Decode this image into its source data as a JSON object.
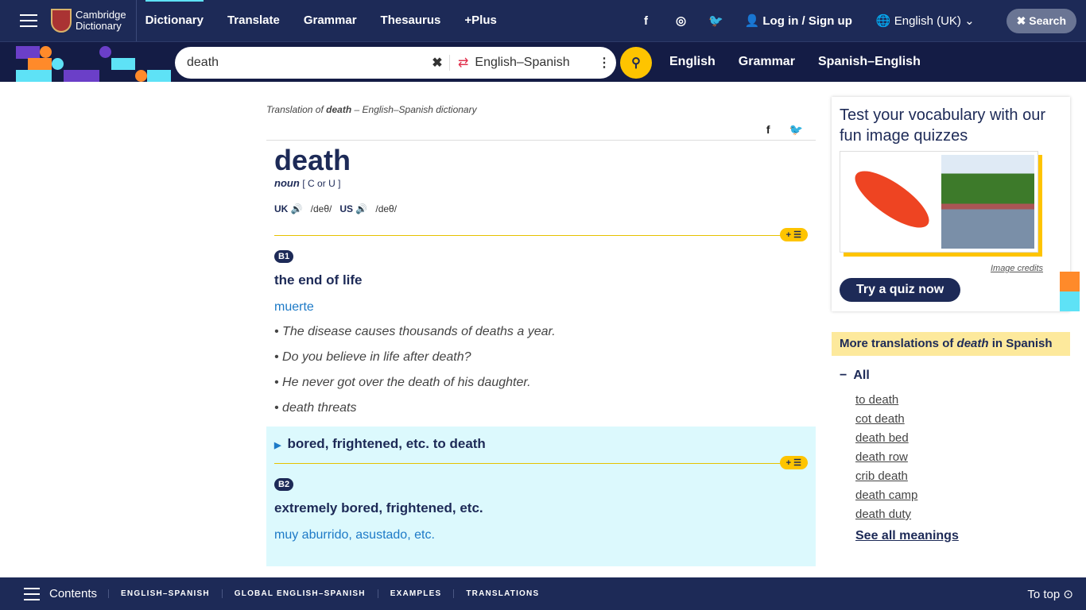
{
  "header": {
    "logo_line1": "Cambridge",
    "logo_line2": "Dictionary",
    "nav": [
      {
        "label": "Dictionary",
        "active": true
      },
      {
        "label": "Translate"
      },
      {
        "label": "Grammar"
      },
      {
        "label": "Thesaurus"
      },
      {
        "label": "+Plus"
      }
    ],
    "social": [
      "f",
      "◎",
      "🐦"
    ],
    "login": "Log in / Sign up",
    "language": "English (UK)",
    "search_button": "Search"
  },
  "searchbar": {
    "value": "death",
    "direction": "English–Spanish",
    "links": [
      "English",
      "Grammar",
      "Spanish–English"
    ]
  },
  "entry": {
    "crumb_pre": "Translation of ",
    "crumb_word": "death",
    "crumb_post": " – English–Spanish dictionary",
    "headword": "death",
    "pos": "noun",
    "grammar": "[ C or U ]",
    "uk_label": "UK",
    "uk_ipa": "/deθ/",
    "us_label": "US",
    "us_ipa": "/deθ/",
    "sense1": {
      "level": "B1",
      "definition": "the end of life",
      "translation": "muerte",
      "examples": [
        "The disease causes thousands of deaths a year.",
        "Do you believe in life after death?",
        "He never got over the death of his daughter.",
        "death threats"
      ]
    },
    "idiom": {
      "title": "bored, frightened, etc. to death",
      "level": "B2",
      "definition": "extremely bored, frightened, etc.",
      "translation": "muy aburrido, asustado, etc."
    },
    "pill": "+ ☰"
  },
  "sidebar": {
    "quiz_title": "Test your vocabulary with our fun image quizzes",
    "credits": "Image credits",
    "quiz_button": "Try a quiz now",
    "more_pre": "More translations of ",
    "more_word": "death",
    "more_post": " in Spanish",
    "all": "All",
    "items": [
      "to death",
      "cot death",
      "death bed",
      "death row",
      "crib death",
      "death camp",
      "death duty"
    ],
    "see_all": "See all meanings"
  },
  "footer": {
    "contents": "Contents",
    "tabs": [
      "ENGLISH–SPANISH",
      "GLOBAL ENGLISH–SPANISH",
      "EXAMPLES",
      "TRANSLATIONS"
    ],
    "to_top": "To top"
  },
  "colors": {
    "navy": "#1d2a57",
    "yellow": "#fec400",
    "link_blue": "#1d7ac7",
    "idiom_bg": "#dcf9fd"
  }
}
